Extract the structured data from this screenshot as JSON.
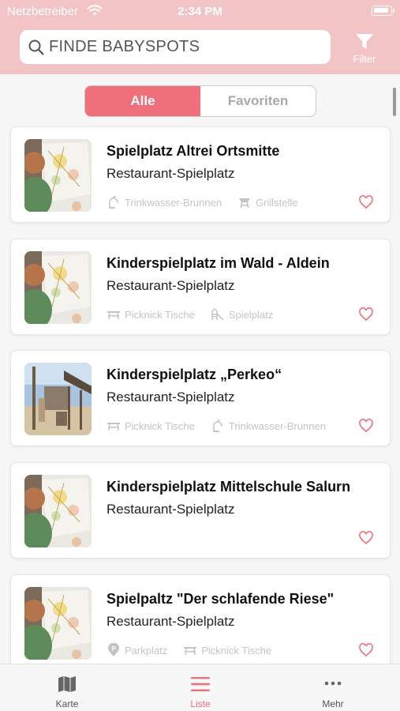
{
  "status_bar": {
    "carrier": "Netzbetreiber",
    "time": "2:34 PM"
  },
  "search": {
    "placeholder": "FINDE BABYSPOTS"
  },
  "filter": {
    "label": "Filter"
  },
  "segments": {
    "all": "Alle",
    "favorites": "Favoriten",
    "selected": "Alle"
  },
  "colors": {
    "header": "#f2c4c6",
    "accent": "#ef6f7a",
    "muted": "#c4c4c4"
  },
  "cards": [
    {
      "title": "Spielplatz Altrei Ortsmitte",
      "subtitle": "Restaurant-Spielplatz",
      "thumbnail": "drawing",
      "features": [
        {
          "icon": "water-fountain-icon",
          "label": "Trinkwasser-Brunnen"
        },
        {
          "icon": "grill-icon",
          "label": "Grillstelle"
        }
      ]
    },
    {
      "title": "Kinderspielplatz im Wald - Aldein",
      "subtitle": "Restaurant-Spielplatz",
      "thumbnail": "drawing",
      "features": [
        {
          "icon": "picnic-table-icon",
          "label": "Picknick Tische"
        },
        {
          "icon": "playground-icon",
          "label": "Spielplatz"
        }
      ]
    },
    {
      "title": "Kinderspielplatz „Perkeo“",
      "subtitle": "Restaurant-Spielplatz",
      "thumbnail": "photo",
      "features": [
        {
          "icon": "picnic-table-icon",
          "label": "Picknick Tische"
        },
        {
          "icon": "water-fountain-icon",
          "label": "Trinkwasser-Brunnen"
        }
      ]
    },
    {
      "title": "Kinderspielplatz Mittelschule Salurn",
      "subtitle": "Restaurant-Spielplatz",
      "thumbnail": "drawing",
      "features": []
    },
    {
      "title": "Spielpaltz \"Der schlafende Riese\"",
      "subtitle": "Restaurant-Spielplatz",
      "thumbnail": "drawing",
      "features": [
        {
          "icon": "parking-icon",
          "label": "Parkplatz"
        },
        {
          "icon": "picnic-table-icon",
          "label": "Picknick Tische"
        }
      ]
    }
  ],
  "tabbar": [
    {
      "icon": "map-icon",
      "label": "Karte",
      "active": false
    },
    {
      "icon": "list-icon",
      "label": "Liste",
      "active": true
    },
    {
      "icon": "more-icon",
      "label": "Mehr",
      "active": false
    }
  ]
}
